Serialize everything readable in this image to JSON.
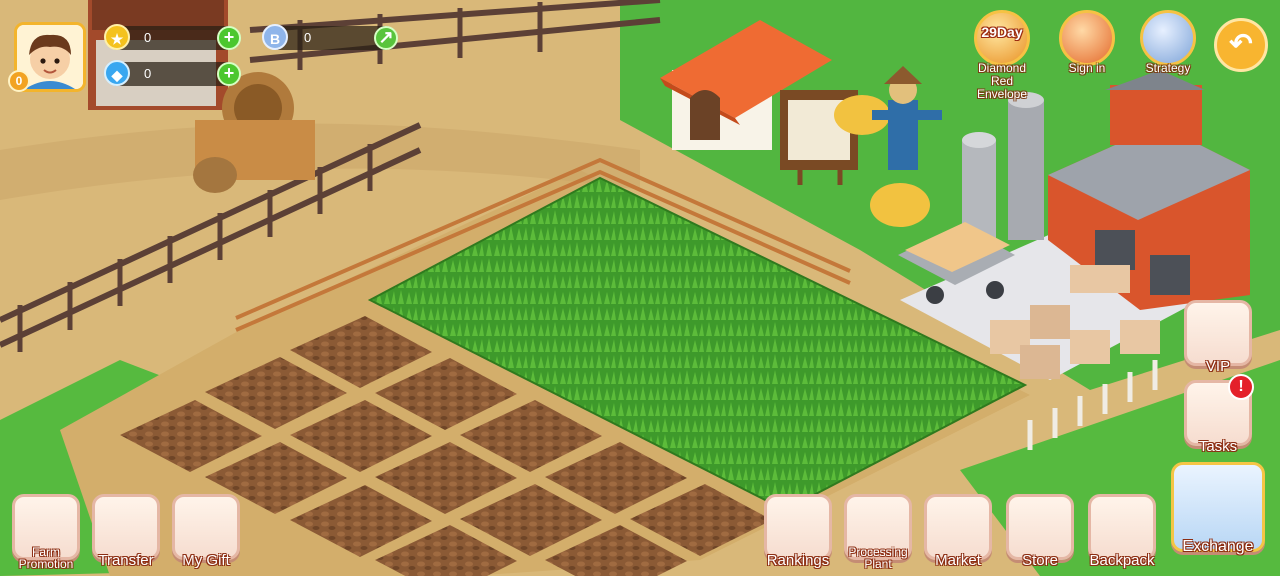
{
  "player": {
    "level": "0",
    "avatar_icon": "boy-avatar-icon"
  },
  "currencies": {
    "gold": {
      "value": "0",
      "icon": "gold-coin-icon"
    },
    "bcoin": {
      "value": "0",
      "icon": "b-coin-icon"
    },
    "diamond": {
      "value": "0",
      "icon": "diamond-icon"
    }
  },
  "top_menu": {
    "red_envelope": {
      "overlay": "29Day",
      "label": "Diamond Red Envelope"
    },
    "sign_in": {
      "label": "Sign in"
    },
    "strategy": {
      "label": "Strategy"
    }
  },
  "side_menu": {
    "vip": {
      "label": "VIP"
    },
    "tasks": {
      "label": "Tasks",
      "alert": "!"
    }
  },
  "bottom_left": [
    {
      "label": "Farm Promotion"
    },
    {
      "label": "Transfer"
    },
    {
      "label": "My Gift"
    }
  ],
  "bottom_right": [
    {
      "label": "Rankings"
    },
    {
      "label": "Processing Plant"
    },
    {
      "label": "Market"
    },
    {
      "label": "Store"
    },
    {
      "label": "Backpack"
    },
    {
      "label": "Exchange"
    }
  ],
  "colors": {
    "sand": "#d7b57a",
    "grass": "#4eb13c",
    "crop": "#3f9a2a",
    "soil": "#8a5a36",
    "accent": "#f3b42c"
  }
}
